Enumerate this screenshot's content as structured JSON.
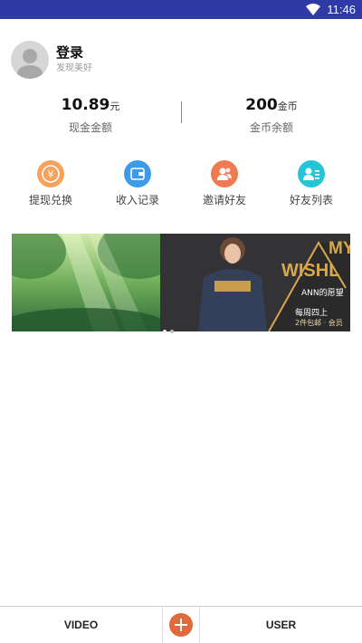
{
  "status_bar": {
    "time": "11:46",
    "wifi_icon": "wifi-icon"
  },
  "profile": {
    "avatar_icon": "default-avatar-icon",
    "login_label": "登录",
    "subtitle": "发现美好"
  },
  "balances": {
    "cash": {
      "value": "10.89",
      "unit": "元",
      "caption": "现金金额"
    },
    "coins": {
      "value": "200",
      "unit": "金币",
      "caption": "金币余额"
    }
  },
  "actions": [
    {
      "label": "提现兑换",
      "icon": "yen-exchange-icon",
      "color": "#f5a25b"
    },
    {
      "label": "收入记录",
      "icon": "wallet-icon",
      "color": "#3d9be9"
    },
    {
      "label": "邀请好友",
      "icon": "invite-friends-icon",
      "color": "#f07a52"
    },
    {
      "label": "好友列表",
      "icon": "friend-list-icon",
      "color": "#24c5d8"
    }
  ],
  "banner": {
    "headline_1": "MY",
    "headline_2": "WISHL",
    "subline": "ANN的愿望",
    "sale_line": "每周四上",
    "gift_line": "2件包邮 · 会员",
    "page_count": 2,
    "active_page": 1
  },
  "tabbar": {
    "video_label": "VIDEO",
    "add_icon": "plus-icon",
    "user_label": "USER"
  },
  "colors": {
    "status_bar": "#2f3aa6",
    "accent_add": "#e06a3c",
    "banner_gold": "#d8a84b"
  }
}
